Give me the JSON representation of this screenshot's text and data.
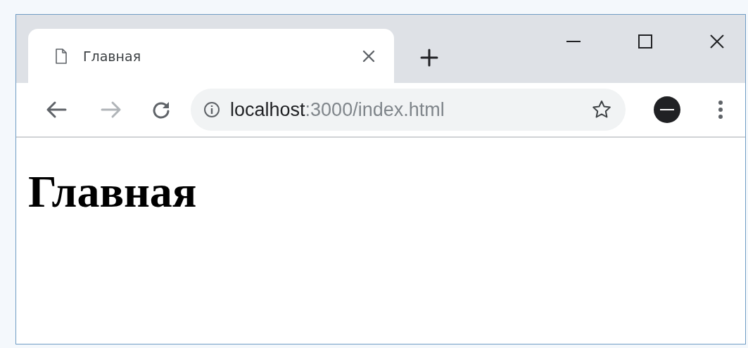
{
  "tabs": [
    {
      "title": "Главная",
      "selected": true
    }
  ],
  "toolbar": {
    "nav": [
      {
        "kind": "back",
        "disabled": false
      },
      {
        "kind": "forward",
        "disabled": true
      },
      {
        "kind": "reload",
        "disabled": false
      }
    ],
    "address": {
      "host": "localhost",
      "path": ":3000/index.html"
    }
  },
  "page": {
    "heading": "Главная"
  }
}
